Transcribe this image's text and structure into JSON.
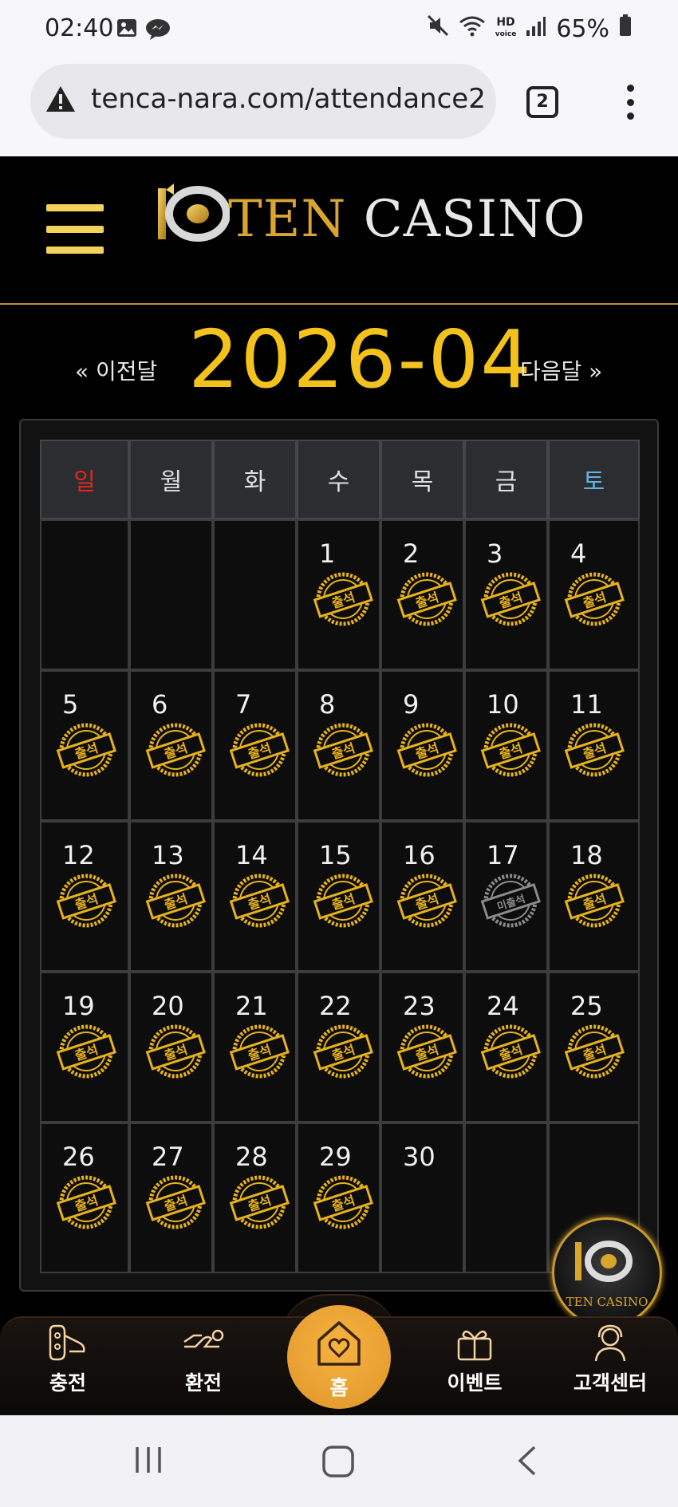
{
  "status_bar": {
    "time": "02:40",
    "hd_label": "HD",
    "voice_label": "voice",
    "battery": "65%",
    "icons": [
      "image-icon",
      "messenger-icon",
      "mute-icon",
      "wifi-icon",
      "signal-icon",
      "battery-icon"
    ]
  },
  "browser": {
    "url": "tenca-nara.com/attendance2",
    "tab_count": "2",
    "icons": [
      "not-secure-warning-icon",
      "tabs-icon",
      "more-menu-icon"
    ]
  },
  "header": {
    "logo_ten": "TEN",
    "logo_casino": "CASINO",
    "menu_icon": "hamburger-menu-icon"
  },
  "month_nav": {
    "prev_label": "« 이전달",
    "title": "2026-04",
    "next_label": "다음달 »"
  },
  "calendar": {
    "weekdays": [
      "일",
      "월",
      "화",
      "수",
      "목",
      "금",
      "토"
    ],
    "weeks": [
      [
        null,
        null,
        null,
        {
          "day": "1",
          "stamp": "출석"
        },
        {
          "day": "2",
          "stamp": "출석"
        },
        {
          "day": "3",
          "stamp": "출석"
        },
        {
          "day": "4",
          "stamp": "출석"
        }
      ],
      [
        {
          "day": "5",
          "stamp": "출석"
        },
        {
          "day": "6",
          "stamp": "출석"
        },
        {
          "day": "7",
          "stamp": "출석"
        },
        {
          "day": "8",
          "stamp": "출석"
        },
        {
          "day": "9",
          "stamp": "출석"
        },
        {
          "day": "10",
          "stamp": "출석"
        },
        {
          "day": "11",
          "stamp": "출석"
        }
      ],
      [
        {
          "day": "12",
          "stamp": "출석"
        },
        {
          "day": "13",
          "stamp": "출석"
        },
        {
          "day": "14",
          "stamp": "출석"
        },
        {
          "day": "15",
          "stamp": "출석"
        },
        {
          "day": "16",
          "stamp": "출석"
        },
        {
          "day": "17",
          "stamp": "미출석"
        },
        {
          "day": "18",
          "stamp": "출석"
        }
      ],
      [
        {
          "day": "19",
          "stamp": "출석"
        },
        {
          "day": "20",
          "stamp": "출석"
        },
        {
          "day": "21",
          "stamp": "출석"
        },
        {
          "day": "22",
          "stamp": "출석"
        },
        {
          "day": "23",
          "stamp": "출석"
        },
        {
          "day": "24",
          "stamp": "출석"
        },
        {
          "day": "25",
          "stamp": "출석"
        }
      ],
      [
        {
          "day": "26",
          "stamp": "출석"
        },
        {
          "day": "27",
          "stamp": "출석"
        },
        {
          "day": "28",
          "stamp": "출석"
        },
        {
          "day": "29",
          "stamp": "출석"
        },
        {
          "day": "30",
          "stamp": null
        },
        null,
        null
      ]
    ],
    "colors": {
      "sunday": "#e3261f",
      "saturday": "#5fb4e0",
      "stamp_attended": "#e8b21c",
      "stamp_absent": "#8a8a8a"
    }
  },
  "floating_logo": {
    "text": "TEN CASINO"
  },
  "bottom_nav": {
    "items": [
      {
        "label": "충전",
        "icon": "deposit-hand-icon"
      },
      {
        "label": "환전",
        "icon": "withdraw-hand-icon"
      },
      {
        "label": "홈",
        "icon": "home-heart-icon"
      },
      {
        "label": "이벤트",
        "icon": "gift-icon"
      },
      {
        "label": "고객센터",
        "icon": "support-agent-icon"
      }
    ]
  },
  "system_nav": {
    "icons": [
      "recent-apps-icon",
      "home-icon",
      "back-icon"
    ]
  },
  "theme": {
    "accent": "#f3c21c",
    "background": "#000000"
  }
}
